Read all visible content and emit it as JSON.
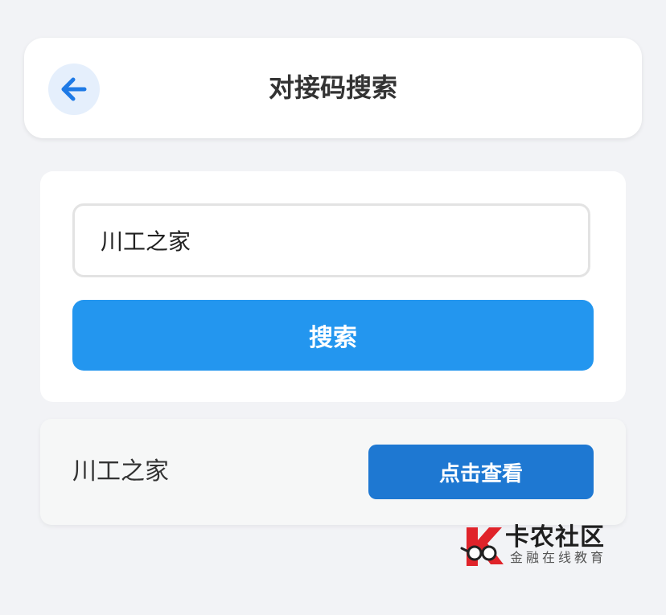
{
  "header": {
    "title": "对接码搜索",
    "back_icon": "arrow-left-icon"
  },
  "search": {
    "input_value": "川工之家",
    "button_label": "搜索"
  },
  "result": {
    "title": "川工之家",
    "button_label": "点击查看"
  },
  "watermark": {
    "name": "卡农社区",
    "tagline": "金融在线教育",
    "logo_icon": "kanong-logo-icon"
  },
  "colors": {
    "background": "#f2f3f6",
    "accent": "#2396ef",
    "view_button": "#1e78d2",
    "back_icon": "#1e7ae6",
    "back_icon_bg": "#e5effc",
    "logo_red": "#e0232a"
  }
}
